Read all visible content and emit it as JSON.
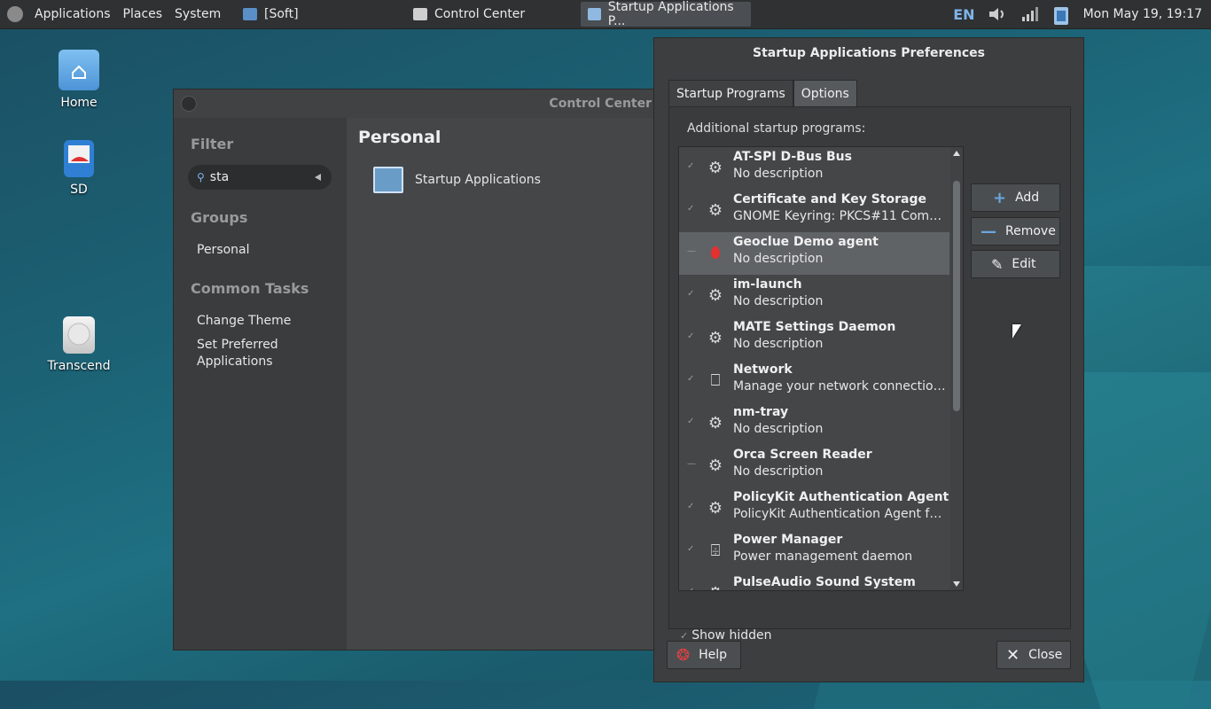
{
  "panel": {
    "menus": [
      "Applications",
      "Places",
      "System"
    ],
    "tasks": [
      {
        "label": "[Soft]"
      },
      {
        "label": "Control Center"
      },
      {
        "label": "Startup Applications P..."
      }
    ],
    "lang": "EN",
    "clock": "Mon May 19, 19:17"
  },
  "desktop": {
    "icons": [
      {
        "label": "Home"
      },
      {
        "label": "SD"
      },
      {
        "label": "Transcend"
      }
    ]
  },
  "control_center": {
    "title": "Control Center",
    "filter_heading": "Filter",
    "search_value": "sta",
    "groups_heading": "Groups",
    "groups": [
      "Personal"
    ],
    "tasks_heading": "Common Tasks",
    "tasks": [
      "Change Theme",
      "Set Preferred\nApplications"
    ],
    "section_title": "Personal",
    "app_label": "Startup Applications"
  },
  "startup": {
    "title": "Startup Applications Preferences",
    "tabs": [
      "Startup Programs",
      "Options"
    ],
    "list_label": "Additional startup programs:",
    "programs": [
      {
        "name": "AT-SPI D-Bus Bus",
        "desc": "No description",
        "checked": true,
        "icon": "gear-icon"
      },
      {
        "name": "Certificate and Key Storage",
        "desc": "GNOME Keyring: PKCS#11 Compo…",
        "checked": true,
        "icon": "gear-icon"
      },
      {
        "name": "Geoclue Demo agent",
        "desc": "No description",
        "checked": false,
        "icon": "map-pin-icon"
      },
      {
        "name": "im-launch",
        "desc": "No description",
        "checked": true,
        "icon": "gear-icon"
      },
      {
        "name": "MATE Settings Daemon",
        "desc": "No description",
        "checked": true,
        "icon": "gear-icon"
      },
      {
        "name": "Network",
        "desc": "Manage your network connections",
        "checked": true,
        "icon": "network-icon"
      },
      {
        "name": "nm-tray",
        "desc": "No description",
        "checked": true,
        "icon": "gear-icon"
      },
      {
        "name": "Orca Screen Reader",
        "desc": "No description",
        "checked": false,
        "icon": "gear-icon"
      },
      {
        "name": "PolicyKit Authentication Agent",
        "desc": "PolicyKit Authentication Agent for …",
        "checked": true,
        "icon": "gear-icon"
      },
      {
        "name": "Power Manager",
        "desc": "Power management daemon",
        "checked": true,
        "icon": "power-manager-icon"
      },
      {
        "name": "PulseAudio Sound System",
        "desc": "",
        "checked": true,
        "icon": "gear-icon"
      }
    ],
    "buttons": {
      "add": "Add",
      "remove": "Remove",
      "edit": "Edit"
    },
    "show_hidden": "Show hidden",
    "help": "Help",
    "close": "Close"
  }
}
